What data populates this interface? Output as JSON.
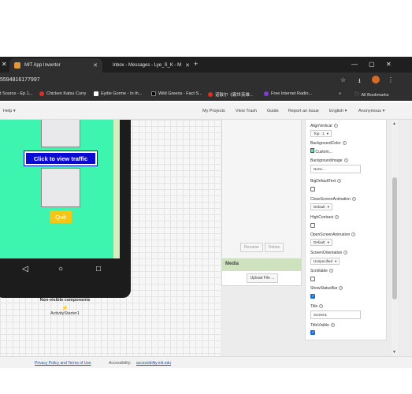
{
  "browser": {
    "tabs": [
      {
        "label": "MIT App Inventor",
        "active": true,
        "favicon_color": "#e0983a"
      },
      {
        "label": "Inbox - Messages - Lye_S_K - M",
        "active": false,
        "favicon_color": "#e0983a"
      }
    ],
    "new_tab": "+",
    "window_controls": [
      "—",
      "▢",
      "✕"
    ],
    "url_fragment": "5594816177997",
    "star_icon": "star-icon",
    "download_icon": "download-icon",
    "menu_icon": "⋮",
    "bookmarks": [
      {
        "label": "t Source - Ep 1...",
        "color": ""
      },
      {
        "label": "Chicken Katsu Curry",
        "color": "#d93025"
      },
      {
        "label": "Eydie Gorme - In th...",
        "color": "#ffffff"
      },
      {
        "label": "Wild Greens - Fact S...",
        "color": "#000000"
      },
      {
        "label": "诺敏尔《霸世英雄...",
        "color": "#d93025"
      },
      {
        "label": "Free Internet Radio...",
        "color": "#7b3fd1"
      }
    ],
    "bookmarks_more": "»",
    "all_bookmarks": "All Bookmarks"
  },
  "app_header": {
    "help": "Help ▾",
    "my_projects": "My Projects",
    "view_trash": "View Trash",
    "guide": "Guide",
    "report_issue": "Report an Issue",
    "language": "English ▾",
    "user": "Anonymous ▾"
  },
  "viewer": {
    "traffic_button": "Click to view traffic",
    "quit_button": "Quit",
    "nav_back": "◁",
    "nav_home": "○",
    "nav_recent": "□",
    "nonvisible_header": "Non-visible components",
    "nonvisible_item": "ActivityStarter1",
    "screen_color": "#3ef5b0"
  },
  "components": {
    "rename": "Rename",
    "delete": "Delete",
    "media_header": "Media",
    "upload_file": "Upload File ..."
  },
  "properties": {
    "align_vertical_label": "AlignVertical",
    "align_vertical_value": "Top : 1",
    "bg_color_label": "BackgroundColor",
    "bg_color_value": "Custom...",
    "bg_image_label": "BackgroundImage",
    "bg_image_value": "None...",
    "big_default_text_label": "BigDefaultText",
    "close_anim_label": "CloseScreenAnimation",
    "close_anim_value": "Default",
    "high_contrast_label": "HighContrast",
    "open_anim_label": "OpenScreenAnimation",
    "open_anim_value": "Default",
    "orientation_label": "ScreenOrientation",
    "orientation_value": "Unspecified",
    "scrollable_label": "Scrollable",
    "show_status_bar_label": "ShowStatusBar",
    "title_label": "Title",
    "title_value": "Screen1",
    "title_visible_label": "TitleVisible",
    "checkboxes": {
      "big_default_text": false,
      "high_contrast": false,
      "scrollable": false,
      "show_status_bar": true,
      "title_visible": true
    }
  },
  "footer": {
    "privacy": "Privacy Policy and Terms of Use",
    "accessibility": "Accessibility:",
    "accessibility_link": "accessibility.mit.edu"
  }
}
